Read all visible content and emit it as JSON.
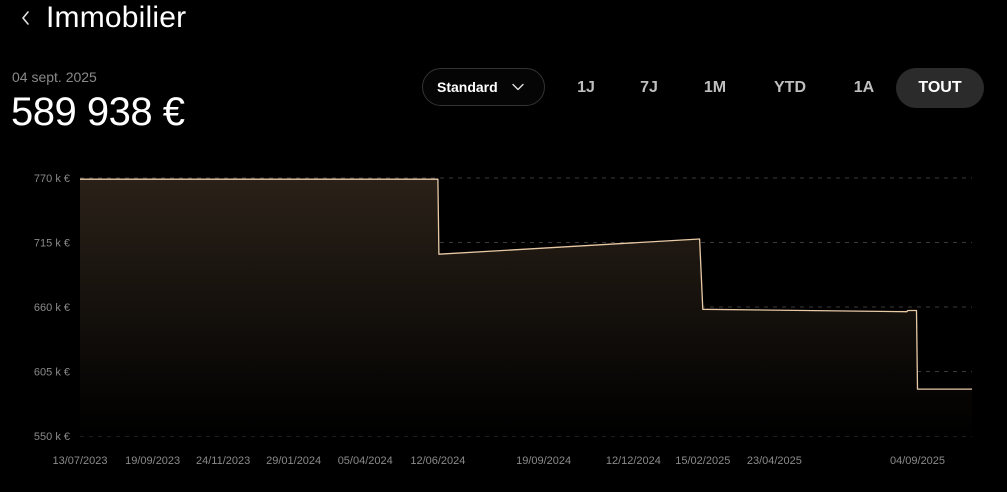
{
  "header": {
    "title": "Immobilier",
    "back_icon": "chevron-left-icon"
  },
  "summary": {
    "date": "04 sept. 2025",
    "value": "589 938 €"
  },
  "controls": {
    "mode_label": "Standard",
    "mode_icon": "chevron-down-icon",
    "ranges": [
      {
        "label": "1J",
        "active": false
      },
      {
        "label": "7J",
        "active": false
      },
      {
        "label": "1M",
        "active": false
      },
      {
        "label": "YTD",
        "active": false
      },
      {
        "label": "1A",
        "active": false
      },
      {
        "label": "TOUT",
        "active": true
      }
    ]
  },
  "colors": {
    "line": "#e8c9a6",
    "fill_top": "#2a2118",
    "grid": "#3a3a3a"
  },
  "chart_data": {
    "type": "area",
    "ylim": [
      550,
      770
    ],
    "y_ticks": [
      550,
      605,
      660,
      715,
      770
    ],
    "y_tick_labels": [
      "550 k €",
      "605 k €",
      "660 k €",
      "715 k €",
      "770 k €"
    ],
    "x_tick_labels": [
      "13/07/2023",
      "19/09/2023",
      "24/11/2023",
      "29/01/2024",
      "05/04/2024",
      "12/06/2024",
      "19/09/2024",
      "12/12/2024",
      "15/02/2025",
      "23/04/2025",
      "04/09/2025"
    ],
    "x_range": [
      "2023-07-13",
      "2025-10-25"
    ],
    "grid": "horizontal dashed",
    "series": [
      {
        "points": [
          [
            "2023-07-13",
            769
          ],
          [
            "2024-06-12",
            769
          ],
          [
            "2024-06-13",
            705
          ],
          [
            "2025-02-12",
            718
          ],
          [
            "2025-02-15",
            658
          ],
          [
            "2025-08-25",
            656
          ],
          [
            "2025-08-26",
            657
          ],
          [
            "2025-09-03",
            657
          ],
          [
            "2025-09-04",
            590
          ],
          [
            "2025-10-25",
            590
          ]
        ]
      }
    ]
  }
}
